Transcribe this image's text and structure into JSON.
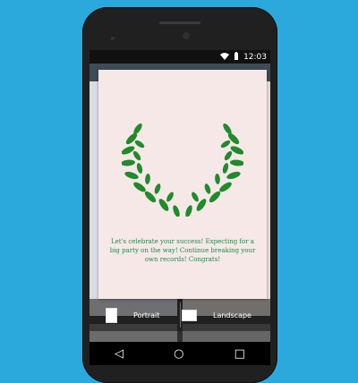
{
  "status": {
    "time": "12:03",
    "wifi_icon": "wifi-icon",
    "battery_icon": "battery-icon"
  },
  "dialog": {
    "message": "Let's celebrate your success! Expecting for a big party on the way! Continue breaking your own records! Congrats!",
    "wreath_icon": "laurel-wreath-icon",
    "wreath_color": "#1f8b2b"
  },
  "orientation": {
    "portrait_label": "Portrait",
    "landscape_label": "Landscape"
  },
  "navbar": {
    "back_icon": "back-icon",
    "home_icon": "home-icon",
    "recents_icon": "recents-icon"
  },
  "colors": {
    "background": "#2ba9dd",
    "dialog_bg": "#f5e8e7",
    "text": "#1c8c49"
  }
}
